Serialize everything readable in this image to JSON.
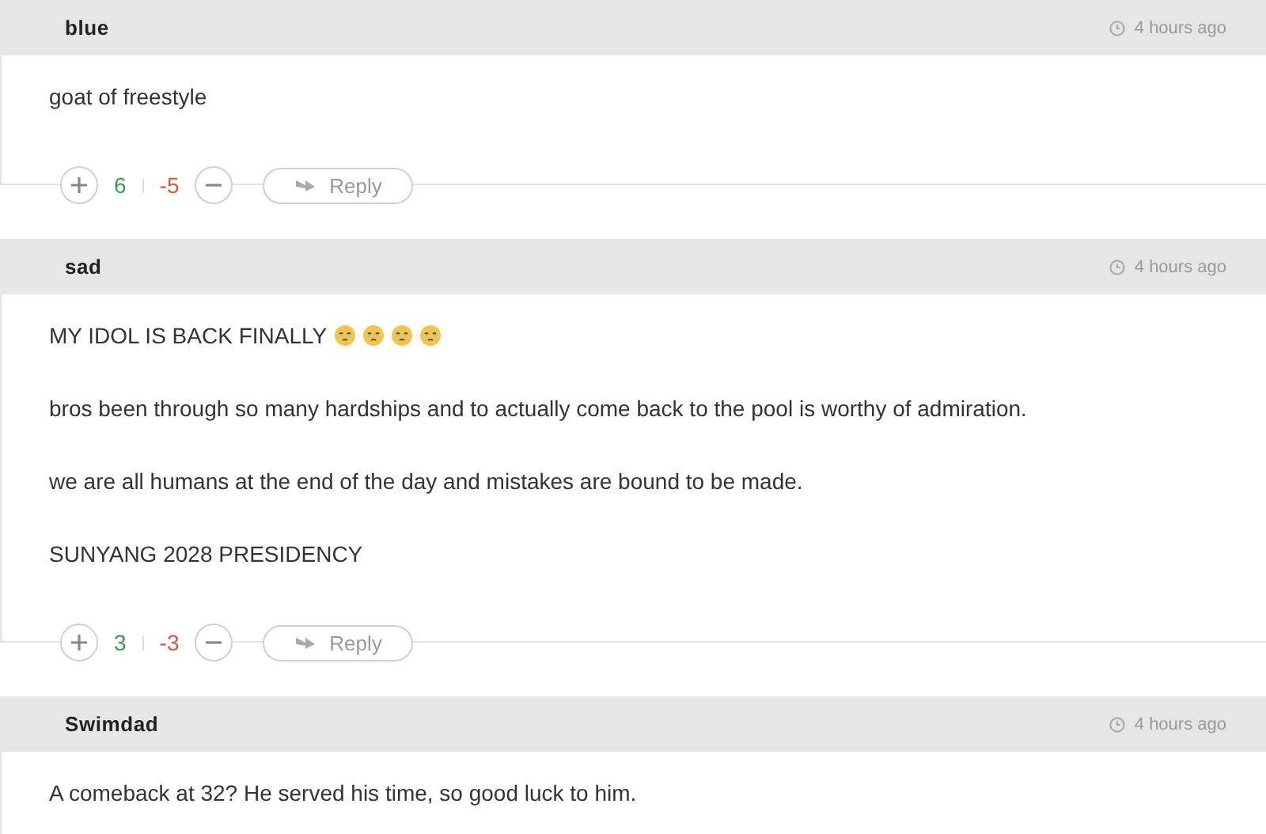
{
  "comments": [
    {
      "author": "blue",
      "time": "4 hours ago",
      "paragraphs": [
        {
          "text": "goat of freestyle"
        }
      ],
      "upvotes": "6",
      "downvotes": "-5",
      "reply_label": "Reply"
    },
    {
      "author": "sad",
      "time": "4 hours ago",
      "paragraphs": [
        {
          "text": "MY IDOL IS BACK FINALLY",
          "icons": [
            {
              "kind": "teary-face"
            },
            {
              "kind": "teary-face"
            },
            {
              "kind": "teary-face"
            },
            {
              "kind": "teary-face"
            }
          ]
        },
        {
          "text": "bros been through so many hardships and to actually come back to the pool is worthy of admiration."
        },
        {
          "text": "we are all humans at the end of the day and mistakes are bound to be made."
        },
        {
          "text": "SUNYANG 2028 PRESIDENCY"
        }
      ],
      "upvotes": "3",
      "downvotes": "-3",
      "reply_label": "Reply"
    },
    {
      "author": "Swimdad",
      "time": "4 hours ago",
      "paragraphs": [
        {
          "text": "A comeback at 32? He served his time, so good luck to him."
        }
      ]
    }
  ]
}
